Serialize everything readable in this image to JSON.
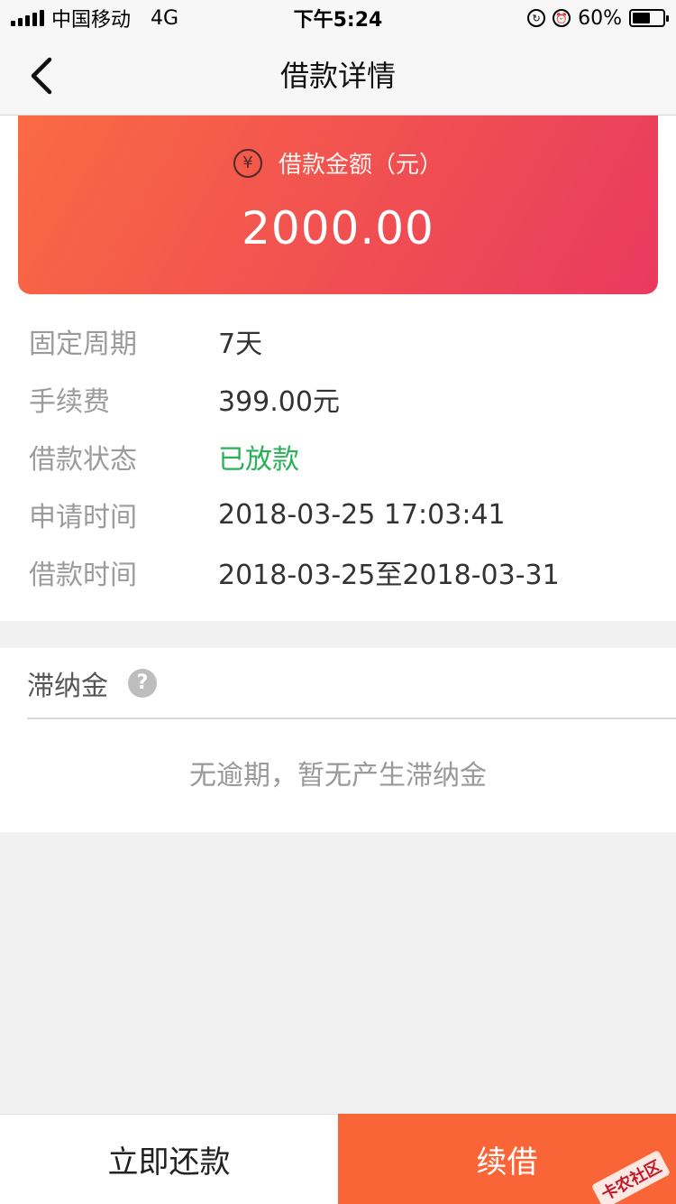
{
  "status_bar": {
    "carrier": "中国移动",
    "network": "4G",
    "time": "下午5:24",
    "battery": "60%",
    "battery_level": 0.6
  },
  "nav": {
    "title": "借款详情"
  },
  "amount_card": {
    "label": "借款金额（元）",
    "currency_symbol": "¥",
    "amount": "2000.00",
    "gradient_start": "#fa6a43",
    "gradient_end": "#e93a5f"
  },
  "info": [
    {
      "label": "固定周期",
      "value": "7天"
    },
    {
      "label": "手续费",
      "value": "399.00元"
    },
    {
      "label": "借款状态",
      "value": "已放款"
    },
    {
      "label": "申请时间",
      "value": "2018-03-25 17:03:41"
    },
    {
      "label": "借款时间",
      "value": "2018-03-25至2018-03-31"
    }
  ],
  "late_fee": {
    "title": "滞纳金",
    "help": "?",
    "note": "无逾期，暂无产生滞纳金"
  },
  "actions": {
    "repay_label": "立即还款",
    "renew_label": "续借",
    "renew_color": "#f96536"
  },
  "watermark": "卡农社区",
  "status_color_green": "#29b157"
}
